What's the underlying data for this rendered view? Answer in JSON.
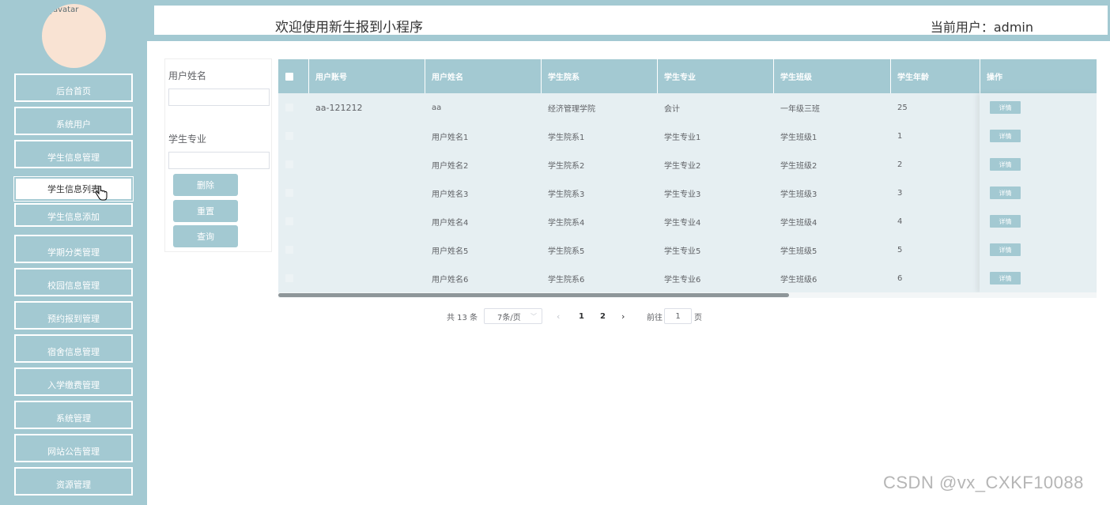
{
  "avatar": {
    "alt_text": "avatar"
  },
  "sidebar": {
    "items": [
      {
        "label": "后台首页"
      },
      {
        "label": "系统用户"
      },
      {
        "label": "学生信息管理"
      },
      {
        "label": "学生信息列表"
      },
      {
        "label": "学生信息添加"
      },
      {
        "label": "学期分类管理"
      },
      {
        "label": "校园信息管理"
      },
      {
        "label": "预约报到管理"
      },
      {
        "label": "宿舍信息管理"
      },
      {
        "label": "入学缴费管理"
      },
      {
        "label": "系统管理"
      },
      {
        "label": "网站公告管理"
      },
      {
        "label": "资源管理"
      }
    ],
    "active_item": "学生信息列表"
  },
  "header": {
    "title": "欢迎使用新生报到小程序",
    "user_label": "当前用户：admin"
  },
  "search": {
    "username_label": "用户姓名",
    "username_value": "",
    "major_label": "学生专业",
    "major_value": "",
    "delete_label": "删除",
    "reset_label": "重置",
    "query_label": "查询"
  },
  "table": {
    "columns": [
      "用户账号",
      "用户姓名",
      "学生院系",
      "学生专业",
      "学生班级",
      "学生年龄",
      "操作"
    ],
    "rows": [
      {
        "account": "aa-121212",
        "name": "aa",
        "department": "经济管理学院",
        "major": "会计",
        "class": "一年级三班",
        "age": "25",
        "action": "详情"
      },
      {
        "account": "",
        "name": "用户姓名1",
        "department": "学生院系1",
        "major": "学生专业1",
        "class": "学生班级1",
        "age": "1",
        "action": "详情"
      },
      {
        "account": "",
        "name": "用户姓名2",
        "department": "学生院系2",
        "major": "学生专业2",
        "class": "学生班级2",
        "age": "2",
        "action": "详情"
      },
      {
        "account": "",
        "name": "用户姓名3",
        "department": "学生院系3",
        "major": "学生专业3",
        "class": "学生班级3",
        "age": "3",
        "action": "详情"
      },
      {
        "account": "",
        "name": "用户姓名4",
        "department": "学生院系4",
        "major": "学生专业4",
        "class": "学生班级4",
        "age": "4",
        "action": "详情"
      },
      {
        "account": "",
        "name": "用户姓名5",
        "department": "学生院系5",
        "major": "学生专业5",
        "class": "学生班级5",
        "age": "5",
        "action": "详情"
      },
      {
        "account": "",
        "name": "用户姓名6",
        "department": "学生院系6",
        "major": "学生专业6",
        "class": "学生班级6",
        "age": "6",
        "action": "详情"
      }
    ]
  },
  "pagination": {
    "total": "共 13 条",
    "page_size": "7条/页",
    "pages": [
      "1",
      "2"
    ],
    "current_page": "1",
    "goto_label": "前往",
    "goto_value": "1",
    "page_unit": "页"
  },
  "watermark": "CSDN @vx_CXKF10088",
  "colors": {
    "theme": "#a3c9d2",
    "avatar_bg": "#f9e3d3",
    "row_bg": "#e6eff2"
  }
}
